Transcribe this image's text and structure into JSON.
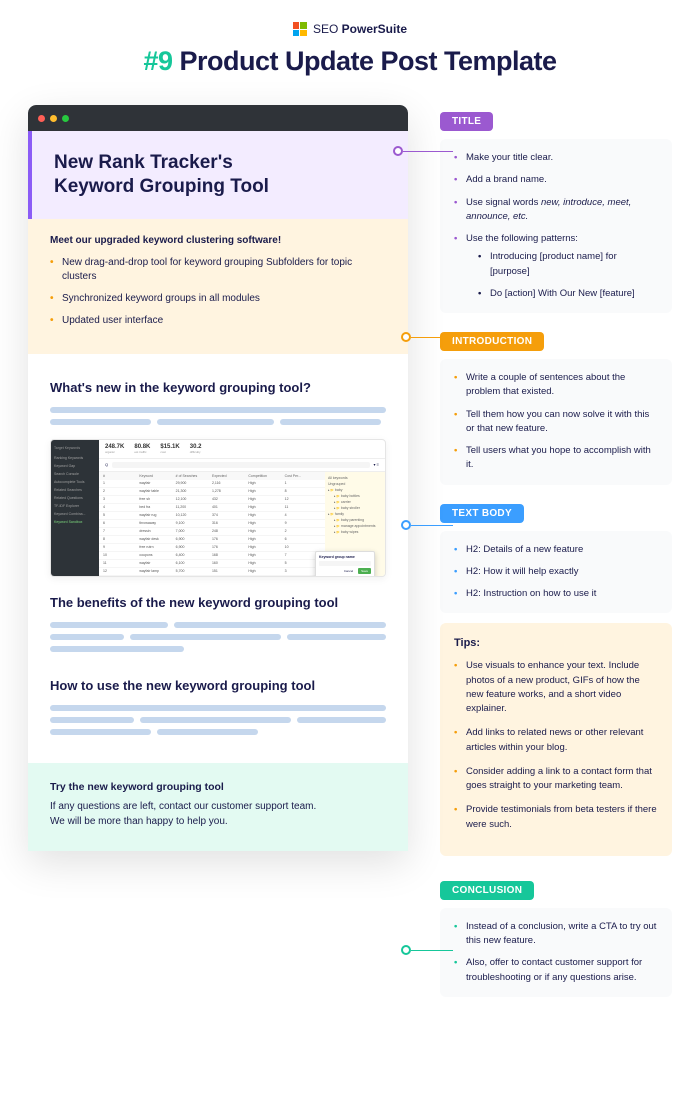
{
  "brand": {
    "prefix": "SEO ",
    "bold": "PowerSuite"
  },
  "main_title": {
    "hash": "#9",
    "text": "  Product Update Post Template"
  },
  "mock": {
    "title_line1": "New Rank Tracker's",
    "title_line2": "Keyword Grouping Tool",
    "intro_lead": "Meet our upgraded keyword clustering software!",
    "intro_bullets": [
      "New drag-and-drop tool for keyword grouping Subfolders for topic clusters",
      "Synchronized keyword groups in all modules",
      "Updated user interface"
    ],
    "h_whatsnew": "What's new in the keyword grouping tool?",
    "h_benefits": "The benefits of the new keyword grouping tool",
    "h_howto": "How to use the new keyword grouping tool",
    "conc_h": "Try the new keyword grouping tool",
    "conc_p1": "If any questions are left, contact our customer support team.",
    "conc_p2": "We will be more than happy to help you.",
    "ss": {
      "side_header": "Target Keywords",
      "side_items": [
        "Ranking Keywords",
        "Keyword Gap",
        "Search Console",
        "Autocomplete Tools",
        "Related Searches",
        "Related Questions",
        "TF-IDF Explorer",
        "Keyword Combina...",
        "Keyword Sandbox"
      ],
      "stats": [
        {
          "v": "248.7K",
          "l": "organic"
        },
        {
          "v": "80.8K",
          "l": "est traffic"
        },
        {
          "v": "$15.1K",
          "l": "cost"
        },
        {
          "v": "30.2",
          "l": "difficulty"
        }
      ],
      "cols": [
        "#",
        "Keyword",
        "# of Searches",
        "Expected",
        "Competition",
        "Cost Per..."
      ],
      "rows": [
        [
          "1",
          "wayfair",
          "29,900",
          "2,116",
          "High",
          "1"
        ],
        [
          "2",
          "wayfair table",
          "21,300",
          "1,278",
          "High",
          "8"
        ],
        [
          "3",
          "free sh",
          "12,100",
          "432",
          "High",
          "12"
        ],
        [
          "4",
          "bed fra",
          "11,200",
          "401",
          "High",
          "11"
        ],
        [
          "5",
          "wayfair rug",
          "10,120",
          "374",
          "High",
          "4"
        ],
        [
          "6",
          "throwaway",
          "9,100",
          "316",
          "High",
          "9"
        ],
        [
          "7",
          "dressin",
          "7,000",
          "248",
          "High",
          "2"
        ],
        [
          "8",
          "wayfair desk",
          "6,900",
          "176",
          "High",
          "6"
        ],
        [
          "9",
          "free rutrn",
          "6,900",
          "176",
          "High",
          "10"
        ],
        [
          "10",
          "coupons",
          "6,400",
          "168",
          "High",
          "7"
        ],
        [
          "11",
          "wayfair",
          "6,100",
          "160",
          "High",
          "5"
        ],
        [
          "12",
          "wayfair lamp",
          "5,700",
          "151",
          "High",
          "3"
        ]
      ],
      "tree": [
        "All keywords",
        "Ungrouped",
        "baby",
        "baby bottles",
        "carrier",
        "baby stroller",
        "family",
        "baby parenting",
        "manage appointments",
        "baby wipes"
      ],
      "modal_h": "Keyword group name",
      "modal_cancel": "Cancel",
      "modal_save": "Save"
    }
  },
  "callouts": {
    "title": {
      "label": "TITLE",
      "items": [
        "Make your title clear.",
        "Add a brand name.",
        "Use signal words <em>new, introduce, meet, announce, etc.</em>",
        "Use the following patterns:"
      ],
      "sub": [
        "Introducing [product name] for [purpose]",
        "Do [action] With Our New [feature]"
      ]
    },
    "intro": {
      "label": "INTRODUCTION",
      "items": [
        "Write a couple of sentences about the problem that existed.",
        "Tell them how you can now solve it with this or that new feature.",
        "Tell users what you hope to accomplish with it."
      ]
    },
    "body": {
      "label": "TEXT BODY",
      "items": [
        "H2: Details of a new feature",
        "H2: How it will help exactly",
        "H2: Instruction on how to use it"
      ]
    },
    "tips": {
      "label": "Tips:",
      "items": [
        "Use visuals to enhance your text. Include photos of a new product, GIFs of how the new feature works, and a short video explainer.",
        "Add links to related news or other relevant articles within your blog.",
        "Consider adding a link to a contact form that goes straight to your marketing team.",
        "Provide testimonials from beta testers if there were such."
      ]
    },
    "conc": {
      "label": "CONCLUSION",
      "items": [
        "Instead of a conclusion, write a CTA to try out this new feature.",
        "Also, offer to contact customer support for troubleshooting or if any questions arise."
      ]
    }
  }
}
